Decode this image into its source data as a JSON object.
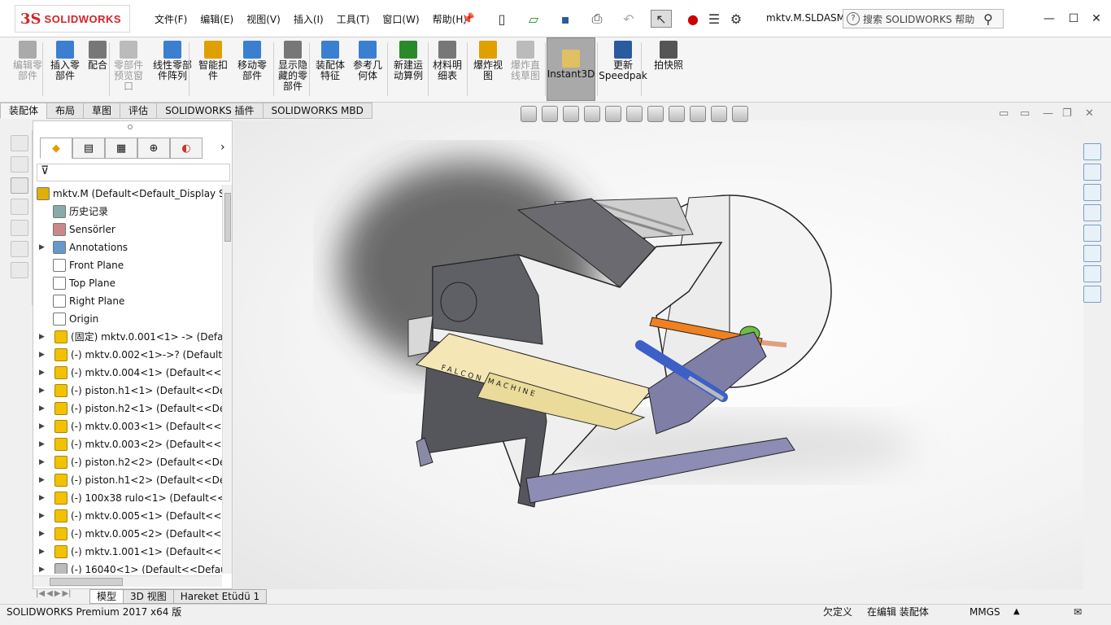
{
  "app": {
    "brand_ds": "3S",
    "brand_name": "SOLIDWORKS",
    "document": "mktv.M.SLDASM"
  },
  "menu": [
    "文件(F)",
    "编辑(E)",
    "视图(V)",
    "插入(I)",
    "工具(T)",
    "窗口(W)",
    "帮助(H)"
  ],
  "search": {
    "placeholder": "搜索 SOLIDWORKS 帮助"
  },
  "ribbon": {
    "buttons": [
      {
        "label": "编辑零\n部件",
        "disabled": true
      },
      {
        "label": "插入零\n部件",
        "disabled": false
      },
      {
        "label": "配合",
        "disabled": false
      },
      {
        "label": "零部件\n预览窗\n口",
        "disabled": true
      },
      {
        "label": "线性零部\n件阵列",
        "disabled": false
      },
      {
        "label": "智能扣\n件",
        "disabled": false
      },
      {
        "label": "移动零\n部件",
        "disabled": false
      },
      {
        "label": "显示隐\n藏的零\n部件",
        "disabled": false
      },
      {
        "label": "装配体\n特征",
        "disabled": false
      },
      {
        "label": "参考几\n何体",
        "disabled": false
      },
      {
        "label": "新建运\n动算例",
        "disabled": false
      },
      {
        "label": "材料明\n细表",
        "disabled": false
      },
      {
        "label": "爆炸视\n图",
        "disabled": false
      },
      {
        "label": "爆炸直\n线草图",
        "disabled": true
      },
      {
        "label": "Instant3D",
        "disabled": false
      },
      {
        "label": "更新\nSpeedpak",
        "disabled": false
      },
      {
        "label": "拍快照",
        "disabled": false
      }
    ]
  },
  "cmd_tabs": [
    "装配体",
    "布局",
    "草图",
    "评估",
    "SOLIDWORKS 插件",
    "SOLIDWORKS MBD"
  ],
  "tree": [
    {
      "label": "mktv.M  (Default<Default_Display S",
      "icon": "assembly-icon",
      "level": 0,
      "exp": false
    },
    {
      "label": "历史记录",
      "icon": "history-icon",
      "level": 1,
      "exp": false
    },
    {
      "label": "Sensörler",
      "icon": "sensor-icon",
      "level": 1,
      "exp": false
    },
    {
      "label": "Annotations",
      "icon": "annotation-icon",
      "level": 1,
      "exp": true
    },
    {
      "label": "Front Plane",
      "icon": "plane-icon",
      "level": 1,
      "exp": false
    },
    {
      "label": "Top Plane",
      "icon": "plane-icon",
      "level": 1,
      "exp": false
    },
    {
      "label": "Right Plane",
      "icon": "plane-icon",
      "level": 1,
      "exp": false
    },
    {
      "label": "Origin",
      "icon": "origin-icon",
      "level": 1,
      "exp": false
    },
    {
      "label": "(固定) mktv.0.001<1> -> (Defau",
      "icon": "part-icon",
      "level": 1,
      "exp": true
    },
    {
      "label": "(-) mktv.0.002<1>->? (Default<",
      "icon": "part-icon",
      "level": 1,
      "exp": true
    },
    {
      "label": "(-) mktv.0.004<1> (Default<<De",
      "icon": "part-icon",
      "level": 1,
      "exp": true
    },
    {
      "label": "(-) piston.h1<1> (Default<<Def",
      "icon": "part-icon",
      "level": 1,
      "exp": true
    },
    {
      "label": "(-) piston.h2<1> (Default<<Def",
      "icon": "part-icon",
      "level": 1,
      "exp": true
    },
    {
      "label": "(-) mktv.0.003<1> (Default<<De",
      "icon": "part-icon",
      "level": 1,
      "exp": true
    },
    {
      "label": "(-) mktv.0.003<2> (Default<<De",
      "icon": "part-icon",
      "level": 1,
      "exp": true
    },
    {
      "label": "(-) piston.h2<2> (Default<<Def",
      "icon": "part-icon",
      "level": 1,
      "exp": true
    },
    {
      "label": "(-) piston.h1<2> (Default<<Def",
      "icon": "part-icon",
      "level": 1,
      "exp": true
    },
    {
      "label": "(-) 100x38 rulo<1> (Default<<D",
      "icon": "part-icon",
      "level": 1,
      "exp": true
    },
    {
      "label": "(-) mktv.0.005<1> (Default<<De",
      "icon": "part-icon",
      "level": 1,
      "exp": true
    },
    {
      "label": "(-) mktv.0.005<2> (Default<<De",
      "icon": "part-icon",
      "level": 1,
      "exp": true
    },
    {
      "label": "(-) mktv.1.001<1> (Default<<De",
      "icon": "part-icon",
      "level": 1,
      "exp": true
    },
    {
      "label": "(-) 16040<1> (Default<<Default",
      "icon": "bolt-icon",
      "level": 1,
      "exp": true
    }
  ],
  "model_text": "FALCON MACHINE",
  "bottom_tabs": [
    "模型",
    "3D 视图",
    "Hareket Etüdü 1"
  ],
  "status": {
    "product": "SOLIDWORKS Premium 2017 x64 版",
    "state": "欠定义",
    "mode": "在编辑 装配体",
    "units": "MMGS"
  },
  "colors": {
    "accent": "#d2232a",
    "part": "#f2c200",
    "selection": "#3c5fc8"
  }
}
